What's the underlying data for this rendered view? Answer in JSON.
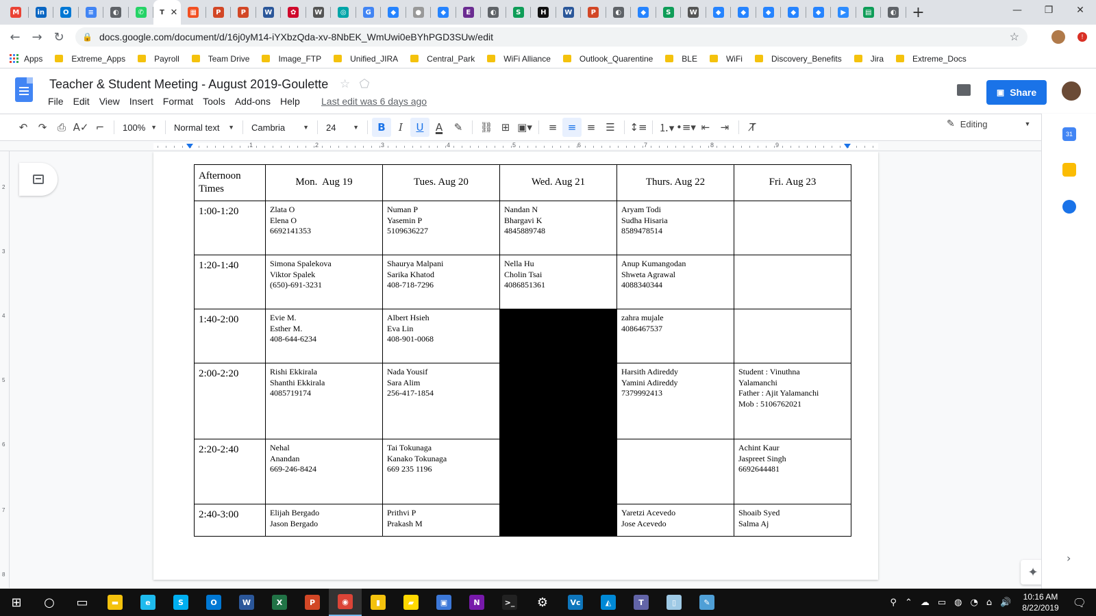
{
  "browser": {
    "tabs": [
      {
        "icon": "gmail-icon",
        "glyph": "M",
        "color": "#ea4335"
      },
      {
        "icon": "linkedin-icon",
        "glyph": "in",
        "color": "#0a66c2"
      },
      {
        "icon": "outlook-icon",
        "glyph": "O",
        "color": "#0078d4"
      },
      {
        "icon": "docs-icon",
        "glyph": "≡",
        "color": "#4285f4"
      },
      {
        "icon": "globe-icon",
        "glyph": "◐",
        "color": "#5f6368"
      },
      {
        "icon": "whatsapp-icon",
        "glyph": "✆",
        "color": "#25d366"
      },
      {
        "icon": "active-tab-icon",
        "glyph": "T",
        "color": "#ffffff",
        "active": true
      },
      {
        "icon": "microsoft-icon",
        "glyph": "▦",
        "color": "#f25022"
      },
      {
        "icon": "powerpoint-icon",
        "glyph": "P",
        "color": "#d24726"
      },
      {
        "icon": "powerpoint-icon",
        "glyph": "P",
        "color": "#d24726"
      },
      {
        "icon": "word-icon",
        "glyph": "W",
        "color": "#2b579a"
      },
      {
        "icon": "huawei-icon",
        "glyph": "✿",
        "color": "#cf0a2c"
      },
      {
        "icon": "wrt-icon",
        "glyph": "W",
        "color": "#555555"
      },
      {
        "icon": "teal-app-icon",
        "glyph": "◎",
        "color": "#00a5a8"
      },
      {
        "icon": "g-icon",
        "glyph": "G",
        "color": "#4285f4"
      },
      {
        "icon": "jira-icon",
        "glyph": "◆",
        "color": "#2684ff"
      },
      {
        "icon": "apple-icon",
        "glyph": "●",
        "color": "#999999"
      },
      {
        "icon": "jira-icon",
        "glyph": "◆",
        "color": "#2684ff"
      },
      {
        "icon": "e-icon",
        "glyph": "E",
        "color": "#6b2c91"
      },
      {
        "icon": "globe-icon",
        "glyph": "◐",
        "color": "#5f6368"
      },
      {
        "icon": "s-icon",
        "glyph": "S",
        "color": "#0f9d58"
      },
      {
        "icon": "htg-icon",
        "glyph": "H",
        "color": "#111111"
      },
      {
        "icon": "word-icon",
        "glyph": "W",
        "color": "#2b579a"
      },
      {
        "icon": "powerpoint-icon",
        "glyph": "P",
        "color": "#d24726"
      },
      {
        "icon": "globe-icon",
        "glyph": "◐",
        "color": "#5f6368"
      },
      {
        "icon": "jira-icon",
        "glyph": "◆",
        "color": "#2684ff"
      },
      {
        "icon": "s-icon",
        "glyph": "S",
        "color": "#0f9d58"
      },
      {
        "icon": "wrt-icon",
        "glyph": "W",
        "color": "#555555"
      },
      {
        "icon": "jira-icon",
        "glyph": "◆",
        "color": "#2684ff"
      },
      {
        "icon": "jira-icon",
        "glyph": "◆",
        "color": "#2684ff"
      },
      {
        "icon": "jira-icon",
        "glyph": "◆",
        "color": "#2684ff"
      },
      {
        "icon": "jira-icon",
        "glyph": "◆",
        "color": "#2684ff"
      },
      {
        "icon": "jira-icon",
        "glyph": "◆",
        "color": "#2684ff"
      },
      {
        "icon": "zoom-icon",
        "glyph": "▶",
        "color": "#2d8cff"
      },
      {
        "icon": "sheets-icon",
        "glyph": "▤",
        "color": "#0f9d58"
      },
      {
        "icon": "globe-icon",
        "glyph": "◐",
        "color": "#5f6368"
      }
    ],
    "active_tab_close": "✕",
    "new_tab": "+",
    "url": "docs.google.com/document/d/16j0yM14-iYXbzQda-xv-8NbEK_WmUwi0eBYhPGD3SUw/edit",
    "bookmarks_apps": "Apps",
    "bookmarks": [
      "Extreme_Apps",
      "Payroll",
      "Team Drive",
      "Image_FTP",
      "Unified_JIRA",
      "Central_Park",
      "WiFi Alliance",
      "Outlook_Quarentine",
      "BLE",
      "WiFi",
      "Discovery_Benefits",
      "Jira",
      "Extreme_Docs"
    ]
  },
  "docs": {
    "title": "Teacher & Student Meeting - August 2019-Goulette",
    "menu": [
      "File",
      "Edit",
      "View",
      "Insert",
      "Format",
      "Tools",
      "Add-ons",
      "Help"
    ],
    "last_edit": "Last edit was 6 days ago",
    "share_label": "Share",
    "toolbar": {
      "zoom": "100%",
      "style": "Normal text",
      "font": "Cambria",
      "size": "24",
      "mode": "Editing"
    },
    "ruler_numbers": [
      "1",
      "1",
      "2",
      "3",
      "4",
      "5",
      "6",
      "7",
      "8",
      "9"
    ],
    "vruler_numbers": [
      "2",
      "3",
      "4",
      "5",
      "6",
      "7",
      "8"
    ]
  },
  "schedule": {
    "corner": "Afternoon\nTimes",
    "days": [
      "Mon.  Aug 19",
      "Tues. Aug 20",
      "Wed. Aug 21",
      "Thurs. Aug 22",
      "Fri. Aug 23"
    ],
    "rows": [
      {
        "time": "1:00-1:20",
        "cells": [
          "Zlata O\nElena O\n6692141353",
          "Numan P\nYasemin P\n5109636227",
          "Nandan N\nBhargavi K\n4845889748",
          "Aryam Todi\nSudha Hisaria\n8589478514",
          ""
        ]
      },
      {
        "time": "1:20-1:40",
        "cells": [
          "Simona Spalekova\nViktor Spalek\n(650)-691-3231",
          "Shaurya Malpani\nSarika Khatod\n408-718-7296",
          "Nella Hu\nCholin Tsai\n4086851361",
          "Anup Kumangodan\nShweta Agrawal\n4088340344",
          ""
        ]
      },
      {
        "time": "1:40-2:00",
        "cells": [
          "Evie M.\nEsther M.\n408-644-6234",
          "Albert Hsieh\nEva Lin\n408-901-0068",
          "",
          "zahra mujale\n4086467537",
          ""
        ]
      },
      {
        "time": "2:00-2:20",
        "cells": [
          "Rishi Ekkirala\nShanthi Ekkirala\n4085719174",
          "Nada Yousif\nSara Alim\n256-417-1854",
          "",
          "Harsith Adireddy\nYamini Adireddy\n7379992413",
          "Student : Vinuthna\nYalamanchi\nFather : Ajit Yalamanchi\nMob : 5106762021"
        ]
      },
      {
        "time": "2:20-2:40",
        "cells": [
          "Nehal\nAnandan\n669-246-8424",
          "Tai Tokunaga\nKanako Tokunaga\n669 235 1196",
          "",
          "",
          "Achint Kaur\nJaspreet Singh\n6692644481"
        ]
      },
      {
        "time": "2:40-3:00",
        "cells": [
          "Elijah Bergado\nJason Bergado",
          "Prithvi P\nPrakash M",
          "",
          "Yaretzi Acevedo\nJose Acevedo",
          "Shoaib Syed\nSalma Aj"
        ]
      }
    ],
    "blocked": [
      [
        2,
        2
      ],
      [
        3,
        2
      ],
      [
        4,
        2
      ],
      [
        5,
        2
      ]
    ]
  },
  "taskbar": {
    "apps": [
      {
        "icon": "windows-start-icon",
        "glyph": "⊞",
        "color": "#101010"
      },
      {
        "icon": "search-icon",
        "glyph": "○",
        "color": "#101010"
      },
      {
        "icon": "task-view-icon",
        "glyph": "▭",
        "color": "#101010"
      },
      {
        "icon": "file-explorer-icon",
        "glyph": "▬",
        "color": "#f4c20d"
      },
      {
        "icon": "internet-explorer-icon",
        "glyph": "e",
        "color": "#1ebbee"
      },
      {
        "icon": "skype-icon",
        "glyph": "S",
        "color": "#00aff0"
      },
      {
        "icon": "outlook-icon",
        "glyph": "O",
        "color": "#0078d4"
      },
      {
        "icon": "word-icon",
        "glyph": "W",
        "color": "#2b579a"
      },
      {
        "icon": "excel-icon",
        "glyph": "X",
        "color": "#217346"
      },
      {
        "icon": "powerpoint-icon",
        "glyph": "P",
        "color": "#d24726"
      },
      {
        "icon": "chrome-icon",
        "glyph": "◉",
        "color": "#db4437",
        "active": true
      },
      {
        "icon": "files-icon",
        "glyph": "▮",
        "color": "#f4c20d"
      },
      {
        "icon": "sticky-notes-icon",
        "glyph": "▰",
        "color": "#ffd800"
      },
      {
        "icon": "network-icon",
        "glyph": "▣",
        "color": "#3c78d8"
      },
      {
        "icon": "onenote-icon",
        "glyph": "N",
        "color": "#7719aa"
      },
      {
        "icon": "terminal-icon",
        "glyph": ">_",
        "color": "#222222"
      },
      {
        "icon": "settings-icon",
        "glyph": "⚙",
        "color": "#101010"
      },
      {
        "icon": "vc-icon",
        "glyph": "Vc",
        "color": "#0e76bc"
      },
      {
        "icon": "azure-icon",
        "glyph": "◭",
        "color": "#0089d6"
      },
      {
        "icon": "teams-icon",
        "glyph": "T",
        "color": "#6264a7"
      },
      {
        "icon": "notepad-icon",
        "glyph": "▯",
        "color": "#9ec9e5"
      },
      {
        "icon": "paint-icon",
        "glyph": "✎",
        "color": "#4f9fd6"
      }
    ],
    "time": "10:16 AM",
    "date": "8/22/2019"
  }
}
